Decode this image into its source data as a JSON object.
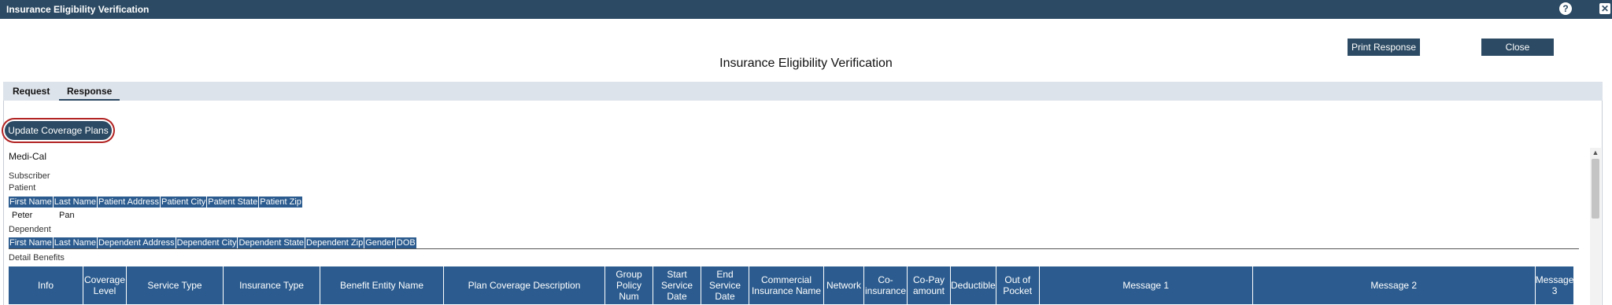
{
  "window": {
    "title": "Insurance Eligibility Verification",
    "help_glyph": "?",
    "close_glyph": "✕"
  },
  "toolbar": {
    "print_label": "Print Response",
    "close_label": "Close"
  },
  "page_title": "Insurance Eligibility Verification",
  "tabs": [
    {
      "label": "Request",
      "active": false
    },
    {
      "label": "Response",
      "active": true
    }
  ],
  "update_button_label": "Update Coverage Plans",
  "payer": "Medi-Cal",
  "subscriber_label": "Subscriber",
  "patient_label": "Patient",
  "patient_columns": [
    "First Name",
    "Last Name",
    "Patient Address",
    "Patient City",
    "Patient State",
    "Patient Zip"
  ],
  "patient_row": {
    "first_name": "Peter",
    "last_name": "Pan"
  },
  "dependent_label": "Dependent",
  "dependent_columns": [
    "First Name",
    "Last Name",
    "Dependent Address",
    "Dependent City",
    "Dependent State",
    "Dependent Zip",
    "Gender",
    "DOB"
  ],
  "detail_benefits_label": "Detail Benefits",
  "benefit_columns": [
    [
      "Info"
    ],
    [
      "Coverage",
      "Level"
    ],
    [
      "Service Type"
    ],
    [
      "Insurance Type"
    ],
    [
      "Benefit Entity Name"
    ],
    [
      "Plan Coverage Description"
    ],
    [
      "Group",
      "Policy",
      "Num"
    ],
    [
      "Start",
      "Service",
      "Date"
    ],
    [
      "End",
      "Service",
      "Date"
    ],
    [
      "Commercial",
      "Insurance Name"
    ],
    [
      "Network"
    ],
    [
      "Co-",
      "insurance"
    ],
    [
      "Co-Pay",
      "amount"
    ],
    [
      "Deductible"
    ],
    [
      "Out of",
      "Pocket"
    ],
    [
      "Message 1"
    ],
    [
      "Message 2"
    ],
    [
      "Message",
      "3"
    ]
  ],
  "colors": {
    "titlebar": "#2c4a63",
    "header_blue": "#2c5c8f",
    "tab_bar": "#dde3ea",
    "highlight_ring": "#b22222"
  },
  "icons": {
    "help": "help-icon",
    "close": "close-icon",
    "scroll_up": "chevron-up-icon"
  }
}
